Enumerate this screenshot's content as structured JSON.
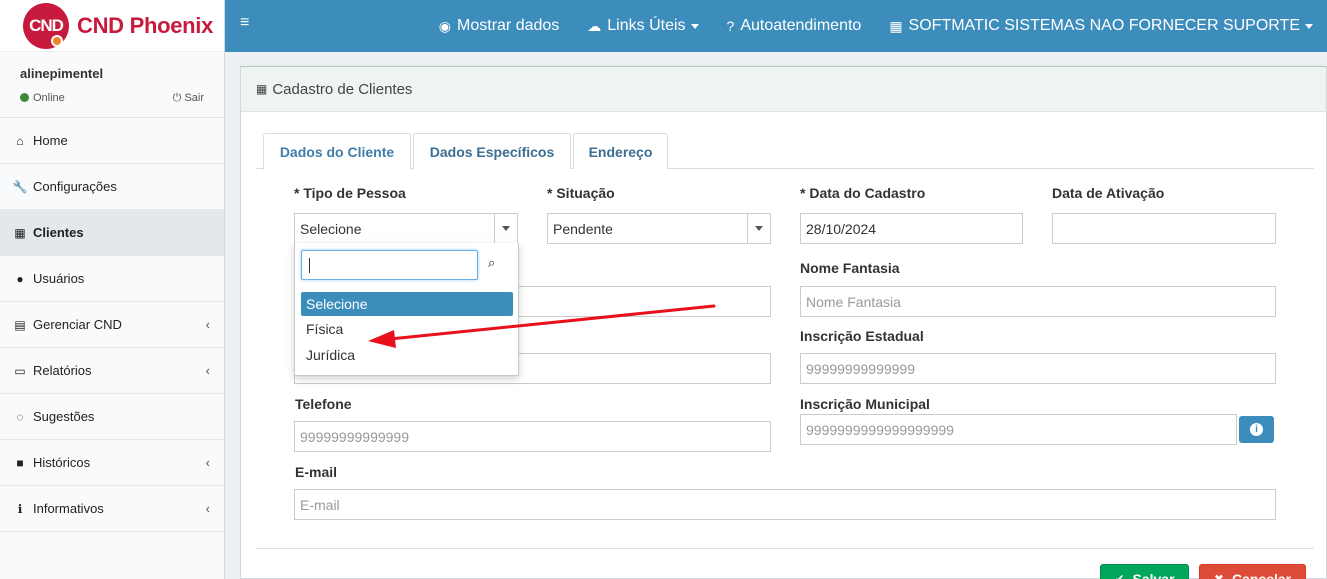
{
  "app": {
    "logo_mark": "CND",
    "logo_text": "CND Phoenix"
  },
  "user": {
    "name": "alinepimentel",
    "status": "Online",
    "logout": "Sair"
  },
  "sidebar": {
    "items": [
      {
        "label": "Home",
        "icon": "home-icon",
        "glyph": "⌂"
      },
      {
        "label": "Configurações",
        "icon": "wrench-icon",
        "glyph": "🔧"
      },
      {
        "label": "Clientes",
        "icon": "building-icon",
        "glyph": "▦"
      },
      {
        "label": "Usuários",
        "icon": "user-icon",
        "glyph": "●"
      },
      {
        "label": "Gerenciar CND",
        "icon": "calendar-icon",
        "glyph": "▤"
      },
      {
        "label": "Relatórios",
        "icon": "file-icon",
        "glyph": "▭"
      },
      {
        "label": "Sugestões",
        "icon": "comments-icon",
        "glyph": "◌"
      },
      {
        "label": "Históricos",
        "icon": "archive-icon",
        "glyph": "■"
      },
      {
        "label": "Informativos",
        "icon": "info-icon",
        "glyph": "ℹ"
      }
    ],
    "chevron": "‹"
  },
  "topbar": {
    "menu_toggle": "≡",
    "show_data": "Mostrar dados",
    "links": "Links Úteis",
    "self_service": "Autoatendimento",
    "company": "SOFTMATIC SISTEMAS NAO FORNECER SUPORTE"
  },
  "box": {
    "title": "Cadastro de Clientes"
  },
  "tabs": [
    "Dados do Cliente",
    "Dados Específicos",
    "Endereço"
  ],
  "form": {
    "tipo_pessoa": {
      "label": "* Tipo de Pessoa",
      "value": "Selecione"
    },
    "situacao": {
      "label": "* Situação",
      "value": "Pendente"
    },
    "data_cadastro": {
      "label": "* Data do Cadastro",
      "value": "28/10/2024"
    },
    "data_ativacao": {
      "label": "Data de Ativação",
      "value": ""
    },
    "nome_fantasia": {
      "label": "Nome Fantasia",
      "placeholder": "Nome Fantasia"
    },
    "inscricao_estadual": {
      "label": "Inscrição Estadual",
      "placeholder": "99999999999999"
    },
    "telefone": {
      "label": "Telefone",
      "placeholder": "99999999999999"
    },
    "inscricao_municipal": {
      "label": "Inscrição Municipal",
      "placeholder": "9999999999999999999"
    },
    "email": {
      "label": "E-mail",
      "placeholder": "E-mail"
    }
  },
  "dropdown": {
    "options": [
      "Selecione",
      "Física",
      "Jurídica"
    ],
    "selected": "Selecione"
  },
  "buttons": {
    "save": "Salvar",
    "cancel": "Cancelar"
  },
  "colors": {
    "topbar": "#3c8dbc",
    "brand": "#c71a3c",
    "save": "#00a65a",
    "cancel": "#dd4b39",
    "annotation_arrow": "#e8101a"
  }
}
